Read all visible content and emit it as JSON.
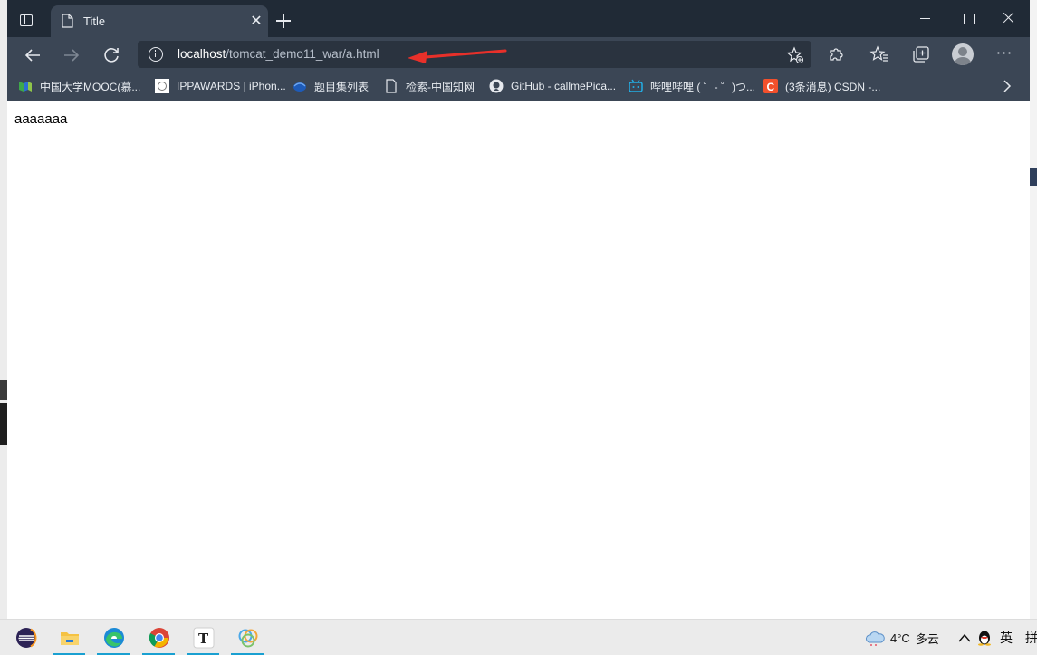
{
  "tab": {
    "title": "Title"
  },
  "address_bar": {
    "host": "localhost",
    "path": "/tomcat_demo11_war/a.html"
  },
  "bookmarks": [
    {
      "label": "中国大学MOOC(慕...",
      "icon": "mooc-icon"
    },
    {
      "label": "IPPAWARDS | iPhon...",
      "icon": "ipp-icon"
    },
    {
      "label": "题目集列表",
      "icon": "pta-icon"
    },
    {
      "label": "检索-中国知网",
      "icon": "page-icon"
    },
    {
      "label": "GitHub - callmePica...",
      "icon": "github-icon"
    },
    {
      "label": "哔哩哔哩 ( ゜- ゜)つ...",
      "icon": "bilibili-icon"
    },
    {
      "label": "(3条消息) CSDN -...",
      "icon": "csdn-icon"
    }
  ],
  "page": {
    "content_text": "aaaaaaa"
  },
  "taskbar": {
    "weather": {
      "temperature": "4°C",
      "condition": "多云"
    },
    "language": "英",
    "ime": "拼"
  },
  "colors": {
    "tabstrip": "#202a36",
    "toolbar": "#3b4655",
    "annotation_arrow": "#e8302a"
  }
}
